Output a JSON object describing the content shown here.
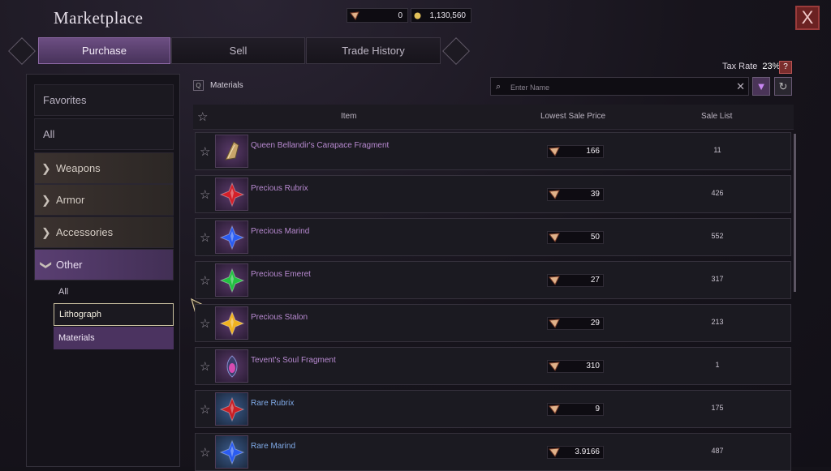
{
  "window": {
    "title": "Marketplace",
    "close_label": "X"
  },
  "currency": {
    "crystals": "0",
    "gold": "1,130,560"
  },
  "tabs": [
    {
      "label": "Purchase",
      "active": true
    },
    {
      "label": "Sell",
      "active": false
    },
    {
      "label": "Trade History",
      "active": false
    }
  ],
  "tax": {
    "label": "Tax Rate",
    "value": "23%",
    "help": "?"
  },
  "sidebar": {
    "favorites": "Favorites",
    "all": "All",
    "categories": [
      {
        "label": "Weapons",
        "open": false
      },
      {
        "label": "Armor",
        "open": false
      },
      {
        "label": "Accessories",
        "open": false
      },
      {
        "label": "Other",
        "open": true
      }
    ],
    "sub_items": [
      {
        "label": "All",
        "state": "normal"
      },
      {
        "label": "Lithograph",
        "state": "hover"
      },
      {
        "label": "Materials",
        "state": "selected"
      }
    ]
  },
  "breadcrumb": {
    "label": "Materials"
  },
  "search": {
    "placeholder": "Enter Name"
  },
  "table": {
    "headers": {
      "item": "Item",
      "price": "Lowest Sale Price",
      "count": "Sale List"
    },
    "rows": [
      {
        "name": "Queen Bellandir's Carapace Fragment",
        "price": "166",
        "count": "11",
        "icon": "carapace-icon",
        "color": "#c8a46a",
        "rarity": "purple"
      },
      {
        "name": "Precious Rubrix",
        "price": "39",
        "count": "426",
        "icon": "red-gem-icon",
        "color": "#d3202a",
        "rarity": "purple"
      },
      {
        "name": "Precious Marind",
        "price": "50",
        "count": "552",
        "icon": "blue-gem-icon",
        "color": "#2b5cf0",
        "rarity": "purple"
      },
      {
        "name": "Precious Emeret",
        "price": "27",
        "count": "317",
        "icon": "green-gem-icon",
        "color": "#23c142",
        "rarity": "purple"
      },
      {
        "name": "Precious Stalon",
        "price": "29",
        "count": "213",
        "icon": "yellow-gem-icon",
        "color": "#f0b220",
        "rarity": "purple"
      },
      {
        "name": "Tevent's Soul Fragment",
        "price": "310",
        "count": "1",
        "icon": "soul-fragment-icon",
        "color": "#d64bb0",
        "rarity": "purple"
      },
      {
        "name": "Rare Rubrix",
        "price": "9",
        "count": "175",
        "icon": "red-gem-icon",
        "color": "#c81f25",
        "rarity": "blue"
      },
      {
        "name": "Rare Marind",
        "price": "3.9166",
        "count": "487",
        "icon": "blue-gem-icon",
        "color": "#2b5cf0",
        "rarity": "blue"
      }
    ]
  }
}
